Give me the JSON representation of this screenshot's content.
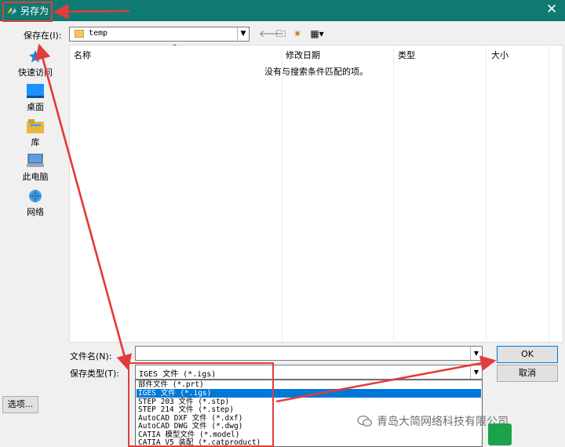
{
  "window": {
    "title": "另存为",
    "close_glyph": "✕"
  },
  "toolbar": {
    "save_in_label": "保存在(I):",
    "location": "temp",
    "back_glyph": "🡐",
    "up_glyph": "🗀",
    "new_folder_glyph": "✷",
    "view_glyph": "▦▾"
  },
  "places": [
    {
      "label": "快速访问",
      "icon": "star-icon"
    },
    {
      "label": "桌面",
      "icon": "desktop-icon"
    },
    {
      "label": "库",
      "icon": "library-icon"
    },
    {
      "label": "此电脑",
      "icon": "computer-icon"
    },
    {
      "label": "网络",
      "icon": "network-icon"
    }
  ],
  "file_list": {
    "columns": [
      "名称",
      "修改日期",
      "类型",
      "大小"
    ],
    "empty_message": "没有与搜索条件匹配的项。"
  },
  "form": {
    "filename_label": "文件名(N):",
    "filename_value": "",
    "filetype_label": "保存类型(T):",
    "filetype_value": "IGES 文件 (*.igs)"
  },
  "buttons": {
    "ok": "OK",
    "cancel": "取消",
    "options": "选项..."
  },
  "filetype_options": [
    "部件文件 (*.prt)",
    "IGES 文件 (*.igs)",
    "STEP 203 文件 (*.stp)",
    "STEP 214 文件 (*.step)",
    "AutoCAD DXF 文件 (*.dxf)",
    "AutoCAD DWG 文件 (*.dwg)",
    "CATIA 模型文件 (*.model)",
    "CATIA V5 装配 (*.catproduct)"
  ],
  "selected_option_index": 1,
  "watermark": "青岛大简网络科技有限公司",
  "colors": {
    "titlebar": "#0f7a72",
    "selection": "#0078d7",
    "annotation": "#e23c3c"
  }
}
